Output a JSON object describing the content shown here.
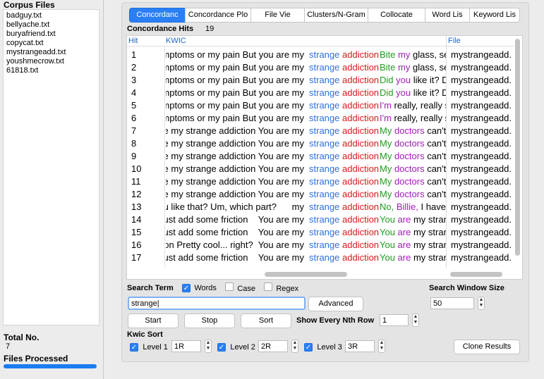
{
  "left": {
    "corpus_title": "Corpus Files",
    "files": [
      "badguy.txt",
      "bellyache.txt",
      "buryafriend.txt",
      "copycat.txt",
      "mystrangeadd.txt",
      "youshmecrow.txt",
      "61818.txt"
    ],
    "total_label": "Total No.",
    "total_value": "7",
    "processed_label": "Files Processed",
    "progress": 1.0
  },
  "tabs": [
    "Concordanc",
    "Concordance Plo",
    "File Vie",
    "Clusters/N-Gram",
    "Collocate",
    "Word Lis",
    "Keyword Lis"
  ],
  "hits": {
    "label": "Concordance Hits",
    "count": "19"
  },
  "table": {
    "headers": {
      "hit": "Hit",
      "kwic": "KWIC",
      "file": "File"
    },
    "rows": [
      {
        "hit": "1",
        "left": "symptoms or my pain But you are my",
        "k1": "strange",
        "k2": "addiction",
        "r": [
          [
            "Bite",
            "green"
          ],
          [
            " my",
            "purple"
          ],
          [
            " glass, set",
            "plain"
          ]
        ],
        "file": "mystrangeadd.t"
      },
      {
        "hit": "2",
        "left": "symptoms or my pain But you are my",
        "k1": "strange",
        "k2": "addiction",
        "r": [
          [
            "Bite",
            "green"
          ],
          [
            " my",
            "purple"
          ],
          [
            " glass, set",
            "plain"
          ]
        ],
        "file": "mystrangeadd.t"
      },
      {
        "hit": "3",
        "left": "symptoms or my pain But you are my",
        "k1": "strange",
        "k2": "addiction",
        "r": [
          [
            "Did",
            "green"
          ],
          [
            " you",
            "purple"
          ],
          [
            " like it? Dic",
            "plain"
          ]
        ],
        "file": "mystrangeadd.t"
      },
      {
        "hit": "4",
        "left": "symptoms or my pain But you are my",
        "k1": "strange",
        "k2": "addiction",
        "r": [
          [
            "Did",
            "green"
          ],
          [
            " you",
            "purple"
          ],
          [
            " like it? Dic",
            "plain"
          ]
        ],
        "file": "mystrangeadd.t"
      },
      {
        "hit": "5",
        "left": "symptoms or my pain But you are my",
        "k1": "strange",
        "k2": "addiction",
        "r": [
          [
            "I'm",
            "purple"
          ],
          [
            " really, really sc",
            "plain"
          ]
        ],
        "file": "mystrangeadd.t"
      },
      {
        "hit": "6",
        "left": "symptoms or my pain But you are my",
        "k1": "strange",
        "k2": "addiction",
        "r": [
          [
            "I'm",
            "purple"
          ],
          [
            " really, really sc",
            "plain"
          ]
        ],
        "file": "mystrangeadd.t"
      },
      {
        "hit": "7",
        "left": "are my strange addiction You are my",
        "k1": "strange",
        "k2": "addiction",
        "r": [
          [
            "My",
            "green"
          ],
          [
            " doctors",
            "purple"
          ],
          [
            " can't e",
            "plain"
          ]
        ],
        "file": "mystrangeadd.t"
      },
      {
        "hit": "8",
        "left": "are my strange addiction You are my",
        "k1": "strange",
        "k2": "addiction",
        "r": [
          [
            "My",
            "green"
          ],
          [
            " doctors",
            "purple"
          ],
          [
            " can't e",
            "plain"
          ]
        ],
        "file": "mystrangeadd.t"
      },
      {
        "hit": "9",
        "left": "are my strange addiction You are my",
        "k1": "strange",
        "k2": "addiction",
        "r": [
          [
            "My",
            "green"
          ],
          [
            " doctors",
            "purple"
          ],
          [
            " can't e",
            "plain"
          ]
        ],
        "file": "mystrangeadd.t"
      },
      {
        "hit": "10",
        "left": "are my strange addiction You are my",
        "k1": "strange",
        "k2": "addiction",
        "r": [
          [
            "My",
            "green"
          ],
          [
            " doctors",
            "purple"
          ],
          [
            " can't e",
            "plain"
          ]
        ],
        "file": "mystrangeadd.t"
      },
      {
        "hit": "11",
        "left": "are my strange addiction You are my",
        "k1": "strange",
        "k2": "addiction",
        "r": [
          [
            "My",
            "green"
          ],
          [
            " doctors",
            "purple"
          ],
          [
            " can't e",
            "plain"
          ]
        ],
        "file": "mystrangeadd.t"
      },
      {
        "hit": "12",
        "left": "are my strange addiction You are my",
        "k1": "strange",
        "k2": "addiction",
        "r": [
          [
            "My",
            "green"
          ],
          [
            " doctors",
            "purple"
          ],
          [
            " can't e",
            "plain"
          ]
        ],
        "file": "mystrangeadd.t"
      },
      {
        "hit": "13",
        "left": "you like that? Um, which part?      my",
        "k1": "strange",
        "k2": "addiction",
        "r": [
          [
            "No,",
            "green"
          ],
          [
            " Billie,",
            "purple"
          ],
          [
            " I haven",
            "plain"
          ]
        ],
        "file": "mystrangeadd.t"
      },
      {
        "hit": "14",
        "left": "e Just add some friction    You are my",
        "k1": "strange",
        "k2": "addiction",
        "r": [
          [
            "You",
            "green"
          ],
          [
            " are",
            "purple"
          ],
          [
            " my strange",
            "plain"
          ]
        ],
        "file": "mystrangeadd.t"
      },
      {
        "hit": "15",
        "left": "e Just add some friction    You are my",
        "k1": "strange",
        "k2": "addiction",
        "r": [
          [
            "You",
            "green"
          ],
          [
            " are",
            "purple"
          ],
          [
            " my strange",
            "plain"
          ]
        ],
        "file": "mystrangeadd.t"
      },
      {
        "hit": "16",
        "left": "ction Pretty cool... right?  You are my",
        "k1": "strange",
        "k2": "addiction",
        "r": [
          [
            "You",
            "green"
          ],
          [
            " are",
            "purple"
          ],
          [
            " my strange",
            "plain"
          ]
        ],
        "file": "mystrangeadd.t"
      },
      {
        "hit": "17",
        "left": "e Just add some friction    You are my",
        "k1": "strange",
        "k2": "addiction",
        "r": [
          [
            "You",
            "green"
          ],
          [
            " are",
            "purple"
          ],
          [
            " my strange",
            "plain"
          ]
        ],
        "file": "mystrangeadd.t"
      }
    ]
  },
  "search": {
    "term_label": "Search Term",
    "words_label": "Words",
    "words_checked": true,
    "case_label": "Case",
    "case_checked": false,
    "regex_label": "Regex",
    "regex_checked": false,
    "value": "strange",
    "advanced_label": "Advanced",
    "window_label": "Search Window Size",
    "window_value": "50",
    "start_label": "Start",
    "stop_label": "Stop",
    "sort_label": "Sort",
    "nth_label": "Show Every Nth Row",
    "nth_value": "1"
  },
  "kwic_sort": {
    "label": "Kwic Sort",
    "levels": [
      {
        "label": "Level 1",
        "value": "1R",
        "checked": true
      },
      {
        "label": "Level 2",
        "value": "2R",
        "checked": true
      },
      {
        "label": "Level 3",
        "value": "3R",
        "checked": true
      }
    ],
    "clone_label": "Clone Results"
  },
  "colors": {
    "accent": "#2a7ff4",
    "node1": "#2f6fd8",
    "node2": "#d81a1a",
    "green": "#1f9d1f",
    "purple": "#a21db8"
  }
}
